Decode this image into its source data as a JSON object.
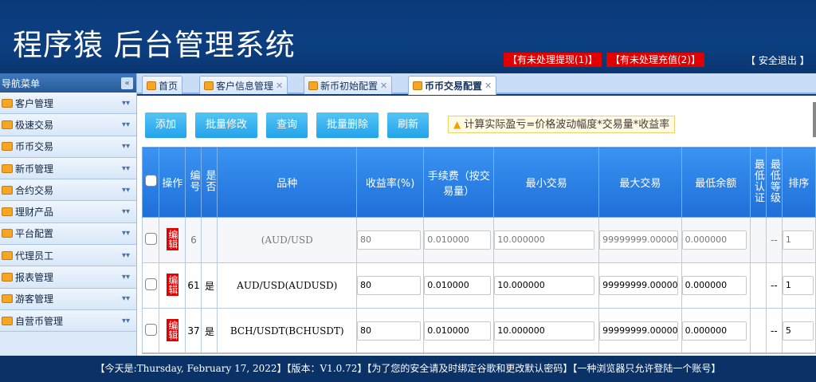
{
  "app": {
    "title": "程序猿 后台管理系统"
  },
  "header": {
    "alerts": [
      "【有未处理提现(1)】",
      "【有未处理充值(2)】"
    ],
    "logout": "【 安全退出 】"
  },
  "sidebar": {
    "title": "导航菜单",
    "items": [
      {
        "label": "客户管理"
      },
      {
        "label": "极速交易"
      },
      {
        "label": "币币交易"
      },
      {
        "label": "新币管理"
      },
      {
        "label": "合约交易"
      },
      {
        "label": "理财产品"
      },
      {
        "label": "平台配置"
      },
      {
        "label": "代理员工"
      },
      {
        "label": "报表管理"
      },
      {
        "label": "游客管理"
      },
      {
        "label": "自营币管理"
      }
    ]
  },
  "tabs": [
    {
      "label": "首页",
      "closable": false
    },
    {
      "label": "客户信息管理",
      "closable": true
    },
    {
      "label": "新币初始配置",
      "closable": true
    },
    {
      "label": "币币交易配置",
      "closable": true,
      "active": true
    }
  ],
  "toolbar": {
    "add": "添加",
    "batch_edit": "批量修改",
    "query": "查询",
    "batch_delete": "批量删除",
    "refresh": "刷新"
  },
  "tip": "计算实际盈亏=价格波动幅度*交易量*收益率",
  "table": {
    "headers": {
      "op": "操作",
      "id": "编号",
      "enabled": "是否",
      "pair": "品种",
      "rate": "收益率(%)",
      "fee": "手续费（按交易量）",
      "min_trade": "最小交易",
      "max_trade": "最大交易",
      "min_balance": "最低余额",
      "min_auth": "最低认证",
      "min_level": "最低等级",
      "sort": "排序"
    },
    "edit_label": "编辑",
    "rows": [
      {
        "id": "6",
        "enabled": "",
        "pair": "(AUD/USD",
        "rate": "80",
        "fee": "0.010000",
        "min_trade": "10.000000",
        "max_trade": "99999999.00000",
        "min_balance": "0.000000",
        "min_auth": "",
        "min_level": "--",
        "sort": "1"
      },
      {
        "id": "61",
        "enabled": "是",
        "pair": "AUD/USD(AUDUSD)",
        "rate": "80",
        "fee": "0.010000",
        "min_trade": "10.000000",
        "max_trade": "99999999.00000",
        "min_balance": "0.000000",
        "min_auth": "",
        "min_level": "--",
        "sort": "1"
      },
      {
        "id": "37",
        "enabled": "是",
        "pair": "BCH/USDT(BCHUSDT)",
        "rate": "80",
        "fee": "0.010000",
        "min_trade": "10.000000",
        "max_trade": "99999999.00000",
        "min_balance": "0.000000",
        "min_auth": "",
        "min_level": "--",
        "sort": "5"
      }
    ]
  },
  "footer": "【今天是:Thursday, February 17, 2022】【版本：V1.0.72】【为了您的安全请及时绑定谷歌和更改默认密码】【一种浏览器只允许登陆一个账号】"
}
